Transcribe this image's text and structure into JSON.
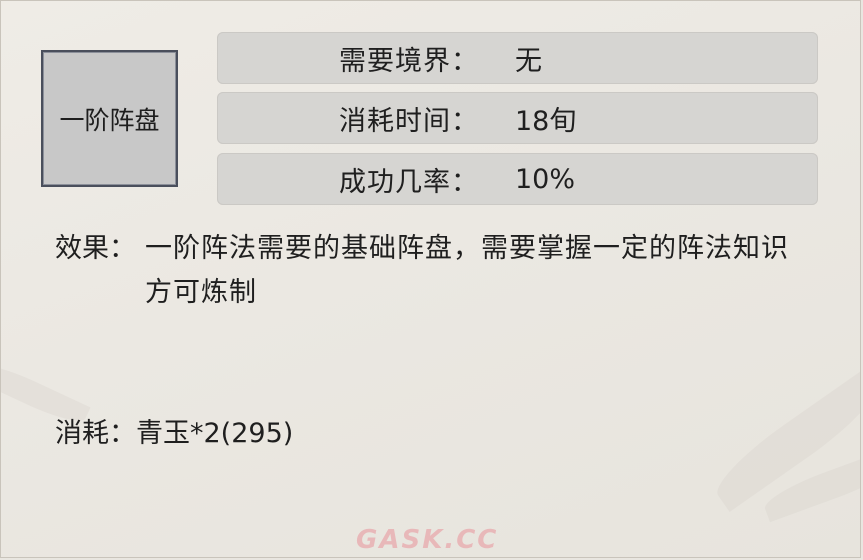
{
  "item": {
    "name": "一阶阵盘"
  },
  "stats": [
    {
      "label": "需要境界：",
      "value": "无"
    },
    {
      "label": "消耗时间：",
      "value": "18旬"
    },
    {
      "label": "成功几率：",
      "value": "10%"
    }
  ],
  "effect": {
    "label": "效果：",
    "text": "一阶阵法需要的基础阵盘，需要掌握一定的阵法知识方可炼制"
  },
  "cost": {
    "label": "消耗：",
    "value": "青玉*2(295)"
  },
  "watermark": "GASK.CC"
}
